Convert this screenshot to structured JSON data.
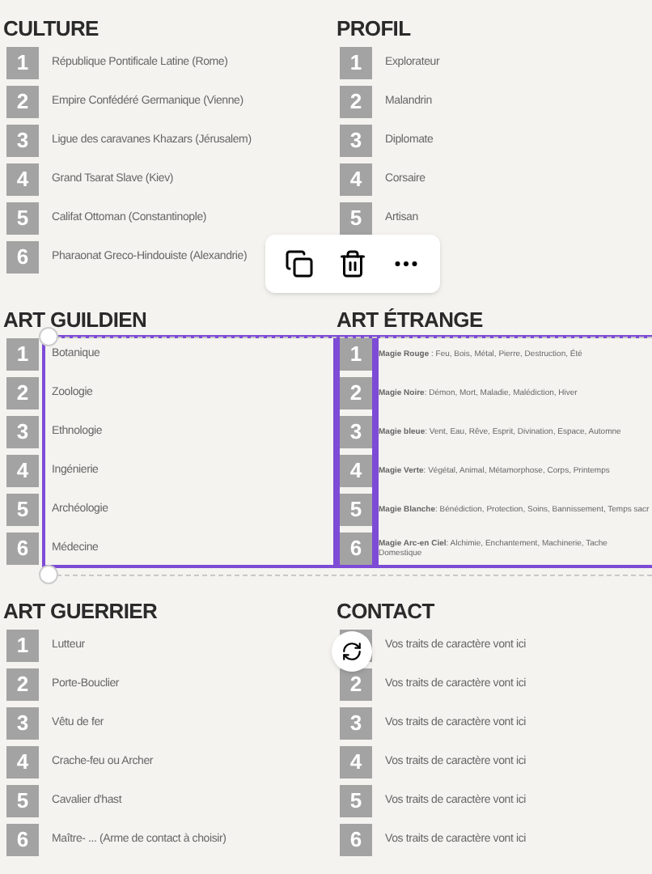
{
  "sections": [
    {
      "title": "CULTURE",
      "numbers_selected": false,
      "text_selected": false,
      "compact": false,
      "items": [
        {
          "number": "1",
          "text": "République Pontificale Latine (Rome)"
        },
        {
          "number": "2",
          "text": "Empire Confédéré Germanique (Vienne)"
        },
        {
          "number": "3",
          "text": "Ligue des caravanes Khazars (Jérusalem)"
        },
        {
          "number": "4",
          "text": "Grand Tsarat Slave  (Kiev)"
        },
        {
          "number": "5",
          "text": "Califat Ottoman (Constantinople)"
        },
        {
          "number": "6",
          "text": "Pharaonat Greco-Hindouiste (Alexandrie)"
        }
      ]
    },
    {
      "title": "PROFIL",
      "numbers_selected": false,
      "text_selected": false,
      "compact": false,
      "items": [
        {
          "number": "1",
          "text": "Explorateur"
        },
        {
          "number": "2",
          "text": "Malandrin"
        },
        {
          "number": "3",
          "text": "Diplomate"
        },
        {
          "number": "4",
          "text": "Corsaire"
        },
        {
          "number": "5",
          "text": "Artisan"
        }
      ]
    },
    {
      "title": "ART GUILDIEN",
      "numbers_selected": false,
      "text_selected": true,
      "compact": false,
      "items": [
        {
          "number": "1",
          "text": "Botanique"
        },
        {
          "number": "2",
          "text": "Zoologie"
        },
        {
          "number": "3",
          "text": "Ethnologie"
        },
        {
          "number": "4",
          "text": "Ingénierie"
        },
        {
          "number": "5",
          "text": "Archéologie"
        },
        {
          "number": "6",
          "text": "Médecine"
        }
      ]
    },
    {
      "title": "ART ÉTRANGE",
      "numbers_selected": true,
      "text_selected": true,
      "compact": true,
      "items": [
        {
          "number": "1",
          "text": "**Magie Rouge** : Feu, Bois, Métal, Pierre, Destruction, Été"
        },
        {
          "number": "2",
          "text": "**Magie Noire**: Démon, Mort, Maladie, Malédiction, Hiver"
        },
        {
          "number": "3",
          "text": "**Magie bleue**: Vent, Eau, Rêve, Esprit, Divination, Espace, Automne"
        },
        {
          "number": "4",
          "text": "**Magie Verte**: Végétal, Animal, Métamorphose, Corps, Printemps"
        },
        {
          "number": "5",
          "text": "**Magie Blanche**: Bénédiction, Protection, Soins, Bannissement, Temps sacr"
        },
        {
          "number": "6",
          "text": "**Magie Arc-en Ciel**: Alchimie, Enchantement, Machinerie, Tache Domestique"
        }
      ]
    },
    {
      "title": "ART GUERRIER",
      "numbers_selected": false,
      "text_selected": false,
      "compact": false,
      "items": [
        {
          "number": "1",
          "text": "Lutteur"
        },
        {
          "number": "2",
          "text": "Porte-Bouclier"
        },
        {
          "number": "3",
          "text": "Vêtu de fer"
        },
        {
          "number": "4",
          "text": "Crache-feu ou Archer"
        },
        {
          "number": "5",
          "text": "Cavalier d'hast"
        },
        {
          "number": "6",
          "text": "Maître- ... (Arme de contact à choisir)"
        }
      ]
    },
    {
      "title": "CONTACT",
      "numbers_selected": false,
      "text_selected": false,
      "compact": false,
      "items": [
        {
          "text": "Vos traits de caractère vont ici"
        },
        {
          "number": "2",
          "text": "Vos traits de caractère vont ici"
        },
        {
          "number": "3",
          "text": "Vos traits de caractère vont ici"
        },
        {
          "number": "4",
          "text": "Vos traits de caractère vont ici"
        },
        {
          "number": "5",
          "text": "Vos traits de caractère vont ici"
        },
        {
          "number": "6",
          "text": "Vos traits de caractère vont ici"
        }
      ]
    }
  ]
}
